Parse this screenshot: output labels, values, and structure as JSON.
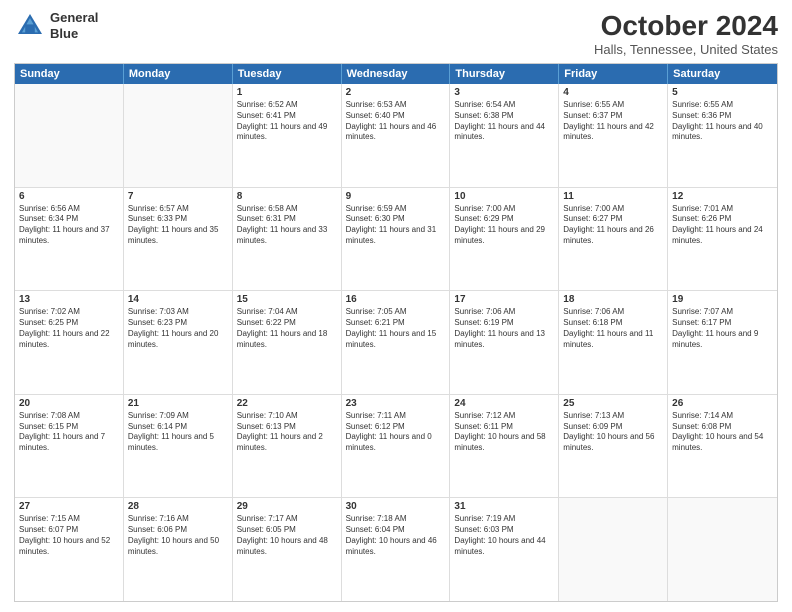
{
  "logo": {
    "line1": "General",
    "line2": "Blue"
  },
  "title": "October 2024",
  "subtitle": "Halls, Tennessee, United States",
  "days": [
    "Sunday",
    "Monday",
    "Tuesday",
    "Wednesday",
    "Thursday",
    "Friday",
    "Saturday"
  ],
  "weeks": [
    [
      {
        "day": "",
        "text": ""
      },
      {
        "day": "",
        "text": ""
      },
      {
        "day": "1",
        "text": "Sunrise: 6:52 AM\nSunset: 6:41 PM\nDaylight: 11 hours and 49 minutes."
      },
      {
        "day": "2",
        "text": "Sunrise: 6:53 AM\nSunset: 6:40 PM\nDaylight: 11 hours and 46 minutes."
      },
      {
        "day": "3",
        "text": "Sunrise: 6:54 AM\nSunset: 6:38 PM\nDaylight: 11 hours and 44 minutes."
      },
      {
        "day": "4",
        "text": "Sunrise: 6:55 AM\nSunset: 6:37 PM\nDaylight: 11 hours and 42 minutes."
      },
      {
        "day": "5",
        "text": "Sunrise: 6:55 AM\nSunset: 6:36 PM\nDaylight: 11 hours and 40 minutes."
      }
    ],
    [
      {
        "day": "6",
        "text": "Sunrise: 6:56 AM\nSunset: 6:34 PM\nDaylight: 11 hours and 37 minutes."
      },
      {
        "day": "7",
        "text": "Sunrise: 6:57 AM\nSunset: 6:33 PM\nDaylight: 11 hours and 35 minutes."
      },
      {
        "day": "8",
        "text": "Sunrise: 6:58 AM\nSunset: 6:31 PM\nDaylight: 11 hours and 33 minutes."
      },
      {
        "day": "9",
        "text": "Sunrise: 6:59 AM\nSunset: 6:30 PM\nDaylight: 11 hours and 31 minutes."
      },
      {
        "day": "10",
        "text": "Sunrise: 7:00 AM\nSunset: 6:29 PM\nDaylight: 11 hours and 29 minutes."
      },
      {
        "day": "11",
        "text": "Sunrise: 7:00 AM\nSunset: 6:27 PM\nDaylight: 11 hours and 26 minutes."
      },
      {
        "day": "12",
        "text": "Sunrise: 7:01 AM\nSunset: 6:26 PM\nDaylight: 11 hours and 24 minutes."
      }
    ],
    [
      {
        "day": "13",
        "text": "Sunrise: 7:02 AM\nSunset: 6:25 PM\nDaylight: 11 hours and 22 minutes."
      },
      {
        "day": "14",
        "text": "Sunrise: 7:03 AM\nSunset: 6:23 PM\nDaylight: 11 hours and 20 minutes."
      },
      {
        "day": "15",
        "text": "Sunrise: 7:04 AM\nSunset: 6:22 PM\nDaylight: 11 hours and 18 minutes."
      },
      {
        "day": "16",
        "text": "Sunrise: 7:05 AM\nSunset: 6:21 PM\nDaylight: 11 hours and 15 minutes."
      },
      {
        "day": "17",
        "text": "Sunrise: 7:06 AM\nSunset: 6:19 PM\nDaylight: 11 hours and 13 minutes."
      },
      {
        "day": "18",
        "text": "Sunrise: 7:06 AM\nSunset: 6:18 PM\nDaylight: 11 hours and 11 minutes."
      },
      {
        "day": "19",
        "text": "Sunrise: 7:07 AM\nSunset: 6:17 PM\nDaylight: 11 hours and 9 minutes."
      }
    ],
    [
      {
        "day": "20",
        "text": "Sunrise: 7:08 AM\nSunset: 6:15 PM\nDaylight: 11 hours and 7 minutes."
      },
      {
        "day": "21",
        "text": "Sunrise: 7:09 AM\nSunset: 6:14 PM\nDaylight: 11 hours and 5 minutes."
      },
      {
        "day": "22",
        "text": "Sunrise: 7:10 AM\nSunset: 6:13 PM\nDaylight: 11 hours and 2 minutes."
      },
      {
        "day": "23",
        "text": "Sunrise: 7:11 AM\nSunset: 6:12 PM\nDaylight: 11 hours and 0 minutes."
      },
      {
        "day": "24",
        "text": "Sunrise: 7:12 AM\nSunset: 6:11 PM\nDaylight: 10 hours and 58 minutes."
      },
      {
        "day": "25",
        "text": "Sunrise: 7:13 AM\nSunset: 6:09 PM\nDaylight: 10 hours and 56 minutes."
      },
      {
        "day": "26",
        "text": "Sunrise: 7:14 AM\nSunset: 6:08 PM\nDaylight: 10 hours and 54 minutes."
      }
    ],
    [
      {
        "day": "27",
        "text": "Sunrise: 7:15 AM\nSunset: 6:07 PM\nDaylight: 10 hours and 52 minutes."
      },
      {
        "day": "28",
        "text": "Sunrise: 7:16 AM\nSunset: 6:06 PM\nDaylight: 10 hours and 50 minutes."
      },
      {
        "day": "29",
        "text": "Sunrise: 7:17 AM\nSunset: 6:05 PM\nDaylight: 10 hours and 48 minutes."
      },
      {
        "day": "30",
        "text": "Sunrise: 7:18 AM\nSunset: 6:04 PM\nDaylight: 10 hours and 46 minutes."
      },
      {
        "day": "31",
        "text": "Sunrise: 7:19 AM\nSunset: 6:03 PM\nDaylight: 10 hours and 44 minutes."
      },
      {
        "day": "",
        "text": ""
      },
      {
        "day": "",
        "text": ""
      }
    ]
  ]
}
